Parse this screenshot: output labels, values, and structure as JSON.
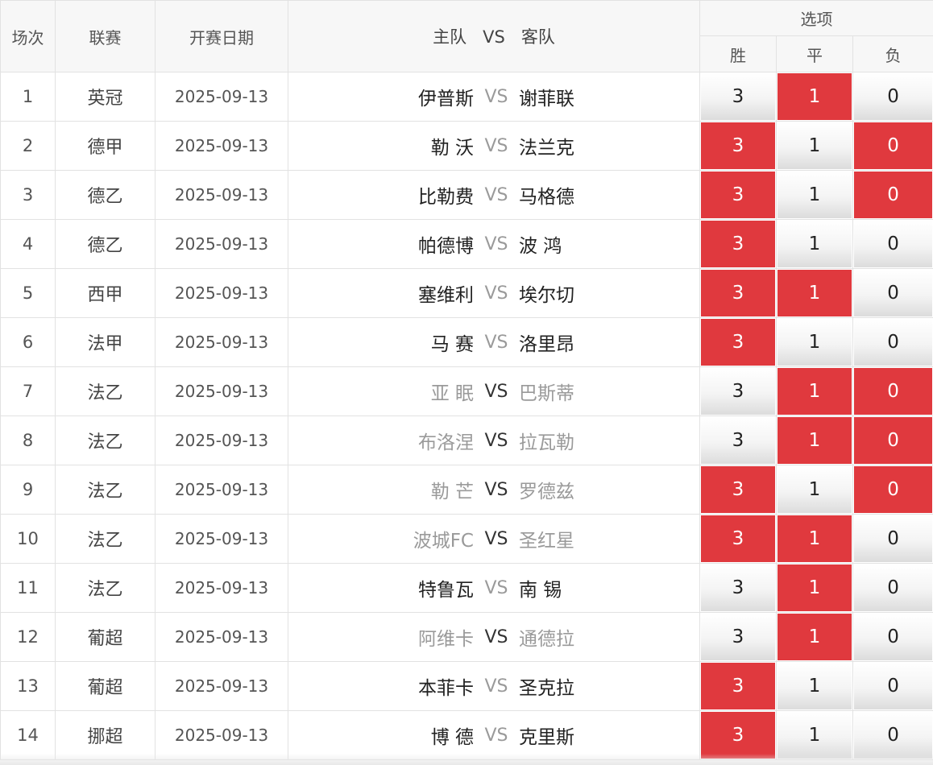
{
  "header": {
    "col_no": "场次",
    "col_league": "联赛",
    "col_date": "开赛日期",
    "col_home": "主队",
    "col_vs": "VS",
    "col_away": "客队",
    "col_options": "选项",
    "opt_win": "胜",
    "opt_draw": "平",
    "opt_lose": "负"
  },
  "colors": {
    "selected": "#e0393e",
    "dim_text": "#9a9a9a"
  },
  "rows": [
    {
      "no": "1",
      "league": "英冠",
      "date": "2025-09-13",
      "home": "伊普斯",
      "vs": "VS",
      "away": "谢菲联",
      "dim": "vs",
      "win": "3",
      "draw": "1",
      "lose": "0",
      "sel": [
        false,
        true,
        false
      ]
    },
    {
      "no": "2",
      "league": "德甲",
      "date": "2025-09-13",
      "home": "勒 沃",
      "vs": "VS",
      "away": "法兰克",
      "dim": "vs",
      "win": "3",
      "draw": "1",
      "lose": "0",
      "sel": [
        true,
        false,
        true
      ]
    },
    {
      "no": "3",
      "league": "德乙",
      "date": "2025-09-13",
      "home": "比勒费",
      "vs": "VS",
      "away": "马格德",
      "dim": "vs",
      "win": "3",
      "draw": "1",
      "lose": "0",
      "sel": [
        true,
        false,
        true
      ]
    },
    {
      "no": "4",
      "league": "德乙",
      "date": "2025-09-13",
      "home": "帕德博",
      "vs": "VS",
      "away": "波 鸿",
      "dim": "vs",
      "win": "3",
      "draw": "1",
      "lose": "0",
      "sel": [
        true,
        false,
        false
      ]
    },
    {
      "no": "5",
      "league": "西甲",
      "date": "2025-09-13",
      "home": "塞维利",
      "vs": "VS",
      "away": "埃尔切",
      "dim": "vs",
      "win": "3",
      "draw": "1",
      "lose": "0",
      "sel": [
        true,
        true,
        false
      ]
    },
    {
      "no": "6",
      "league": "法甲",
      "date": "2025-09-13",
      "home": "马 赛",
      "vs": "VS",
      "away": "洛里昂",
      "dim": "vs",
      "win": "3",
      "draw": "1",
      "lose": "0",
      "sel": [
        true,
        false,
        false
      ]
    },
    {
      "no": "7",
      "league": "法乙",
      "date": "2025-09-13",
      "home": "亚 眠",
      "vs": "VS",
      "away": "巴斯蒂",
      "dim": "teams",
      "win": "3",
      "draw": "1",
      "lose": "0",
      "sel": [
        false,
        true,
        true
      ]
    },
    {
      "no": "8",
      "league": "法乙",
      "date": "2025-09-13",
      "home": "布洛涅",
      "vs": "VS",
      "away": "拉瓦勒",
      "dim": "teams",
      "win": "3",
      "draw": "1",
      "lose": "0",
      "sel": [
        false,
        true,
        true
      ]
    },
    {
      "no": "9",
      "league": "法乙",
      "date": "2025-09-13",
      "home": "勒 芒",
      "vs": "VS",
      "away": "罗德兹",
      "dim": "teams",
      "win": "3",
      "draw": "1",
      "lose": "0",
      "sel": [
        true,
        false,
        true
      ]
    },
    {
      "no": "10",
      "league": "法乙",
      "date": "2025-09-13",
      "home": "波城FC",
      "vs": "VS",
      "away": "圣红星",
      "dim": "teams",
      "win": "3",
      "draw": "1",
      "lose": "0",
      "sel": [
        true,
        true,
        false
      ]
    },
    {
      "no": "11",
      "league": "法乙",
      "date": "2025-09-13",
      "home": "特鲁瓦",
      "vs": "VS",
      "away": "南 锡",
      "dim": "vs",
      "win": "3",
      "draw": "1",
      "lose": "0",
      "sel": [
        false,
        true,
        false
      ]
    },
    {
      "no": "12",
      "league": "葡超",
      "date": "2025-09-13",
      "home": "阿维卡",
      "vs": "VS",
      "away": "通德拉",
      "dim": "teams",
      "win": "3",
      "draw": "1",
      "lose": "0",
      "sel": [
        false,
        true,
        false
      ]
    },
    {
      "no": "13",
      "league": "葡超",
      "date": "2025-09-13",
      "home": "本菲卡",
      "vs": "VS",
      "away": "圣克拉",
      "dim": "vs",
      "win": "3",
      "draw": "1",
      "lose": "0",
      "sel": [
        true,
        false,
        false
      ]
    },
    {
      "no": "14",
      "league": "挪超",
      "date": "2025-09-13",
      "home": "博 德",
      "vs": "VS",
      "away": "克里斯",
      "dim": "vs",
      "win": "3",
      "draw": "1",
      "lose": "0",
      "sel": [
        true,
        false,
        false
      ]
    }
  ]
}
